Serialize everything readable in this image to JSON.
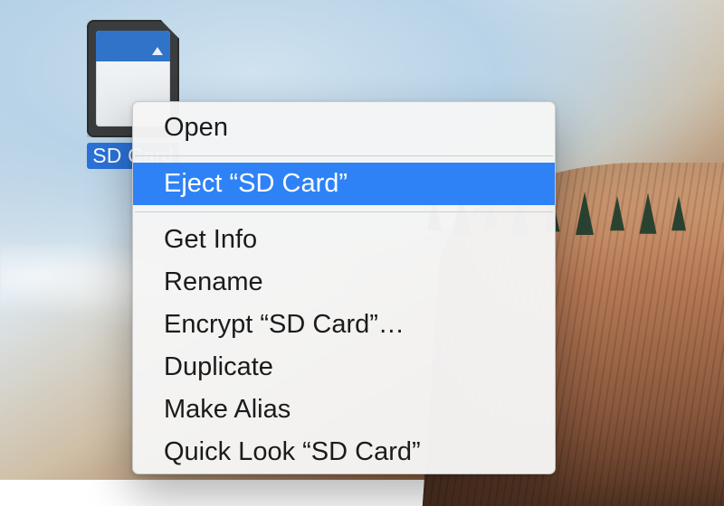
{
  "desktop": {
    "icon_label": "SD Card"
  },
  "menu": {
    "items": [
      {
        "label": "Open",
        "highlight": false
      },
      {
        "label": "Eject “SD Card”",
        "highlight": true
      },
      {
        "label": "Get Info",
        "highlight": false
      },
      {
        "label": "Rename",
        "highlight": false
      },
      {
        "label": "Encrypt “SD Card”…",
        "highlight": false
      },
      {
        "label": "Duplicate",
        "highlight": false
      },
      {
        "label": "Make Alias",
        "highlight": false
      },
      {
        "label": "Quick Look “SD Card”",
        "highlight": false
      }
    ]
  },
  "colors": {
    "highlight_bg": "#2e82f6",
    "selection_bg": "#2b72d8"
  }
}
